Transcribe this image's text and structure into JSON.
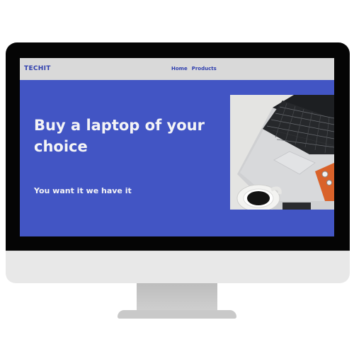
{
  "site": {
    "logo_text": "TECHIT",
    "nav": [
      {
        "label": "Home"
      },
      {
        "label": "Products"
      }
    ]
  },
  "hero": {
    "headline": "Buy a laptop of your choice",
    "subheadline": "You want it we have it",
    "image_alt_icon": "laptop-photo"
  },
  "colors": {
    "screen_background": "#4255c4",
    "navbar_background": "#d9d9d9",
    "brand_blue": "#2f3fae",
    "text_light": "#f4f4f6"
  }
}
